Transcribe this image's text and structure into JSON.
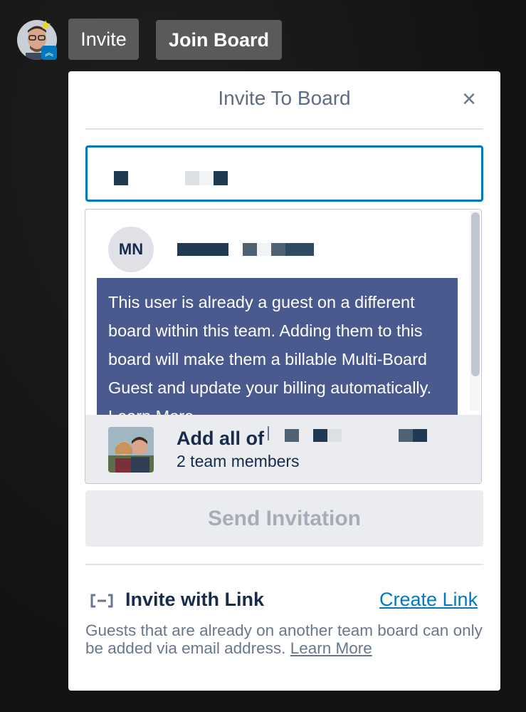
{
  "header": {
    "invite_label": "Invite",
    "join_board_label": "Join Board"
  },
  "popover": {
    "title": "Invite To Board",
    "close_icon": "close-icon",
    "search": {
      "value": "",
      "placeholder": ""
    },
    "result": {
      "initials": "MN",
      "warning": "This user is already a guest on a different board within this team. Adding them to this board will make them a billable Multi-Board Guest and update your billing automatically. Learn More"
    },
    "team_suggestion": {
      "title": "Add all of",
      "subtitle": "2 team members"
    },
    "send_label": "Send Invitation",
    "link_section": {
      "label": "Invite with Link",
      "create_link_label": "Create Link",
      "help_text": "Guests that are already on another team board can only be added via email address.",
      "learn_more_label": "Learn More"
    }
  },
  "colors": {
    "accent": "#0079bf",
    "info_box": "#4a5a8f",
    "text_dark": "#172b4d",
    "text_muted": "#6b778c"
  }
}
